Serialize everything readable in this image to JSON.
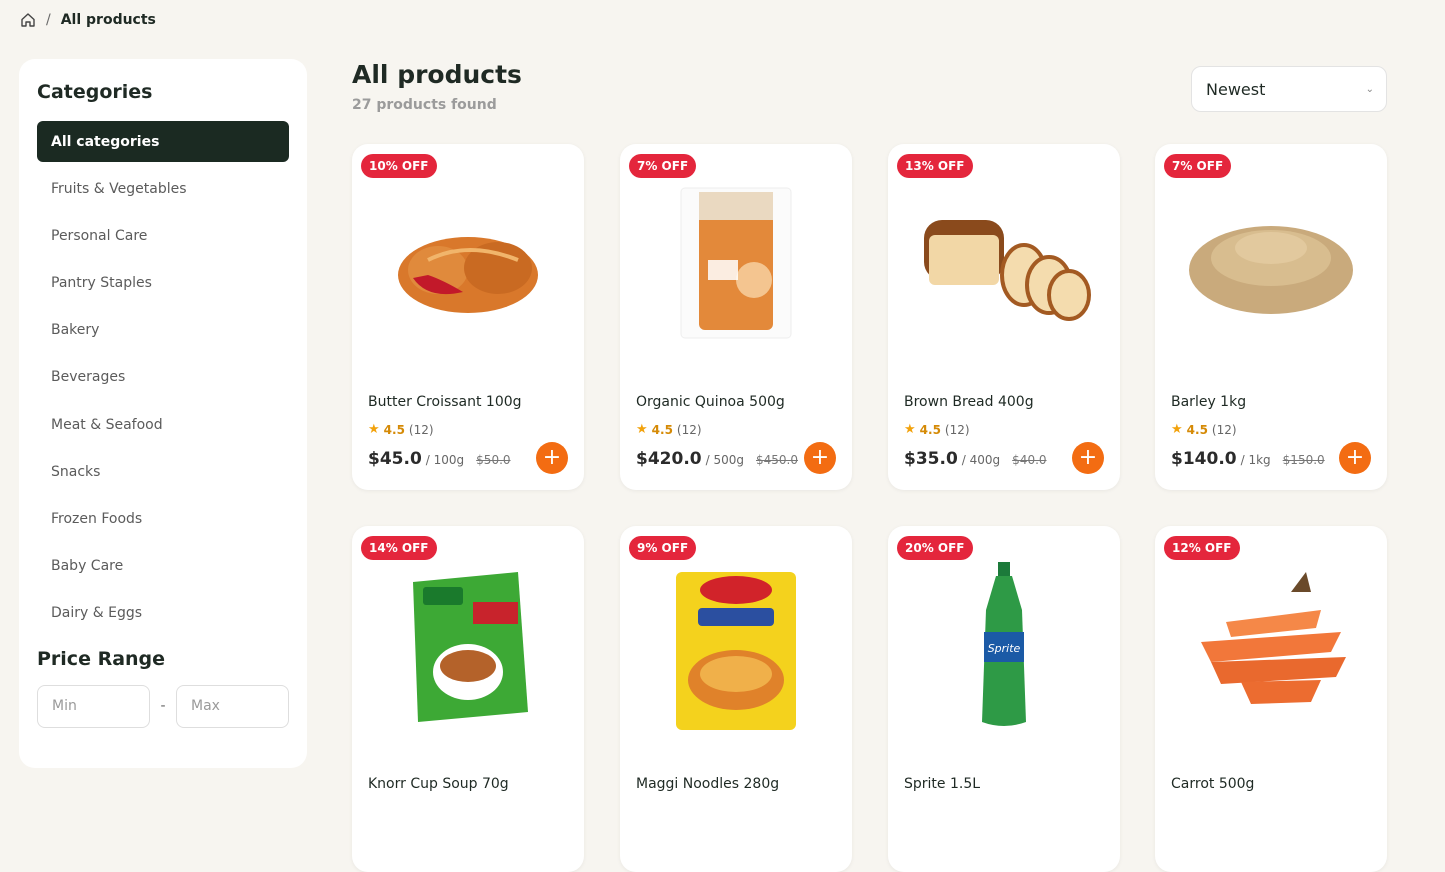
{
  "breadcrumb": {
    "separator": "/",
    "current": "All products"
  },
  "sidebar": {
    "categories_title": "Categories",
    "categories": [
      "All categories",
      "Fruits & Vegetables",
      "Personal Care",
      "Pantry Staples",
      "Bakery",
      "Beverages",
      "Meat & Seafood",
      "Snacks",
      "Frozen Foods",
      "Baby Care",
      "Dairy & Eggs"
    ],
    "active_category": "All categories",
    "price_title": "Price Range",
    "min_placeholder": "Min",
    "max_placeholder": "Max",
    "dash": "-"
  },
  "main": {
    "title": "All products",
    "found": "27 products found",
    "sort": {
      "selected": "Newest"
    }
  },
  "colors": {
    "accent": "#f36c12",
    "badge": "#e4263c",
    "active": "#1b2a22",
    "star": "#f2a20c"
  },
  "products": [
    {
      "badge": "10% OFF",
      "name": "Butter Croissant 100g",
      "rating": "4.5",
      "reviews": "(12)",
      "price": "$45.0",
      "unit": "/ 100g",
      "old": "$50.0",
      "icon": "croissant-icon"
    },
    {
      "badge": "7% OFF",
      "name": "Organic Quinoa 500g",
      "rating": "4.5",
      "reviews": "(12)",
      "price": "$420.0",
      "unit": "/ 500g",
      "old": "$450.0",
      "icon": "quinoa-bag-icon"
    },
    {
      "badge": "13% OFF",
      "name": "Brown Bread 400g",
      "rating": "4.5",
      "reviews": "(12)",
      "price": "$35.0",
      "unit": "/ 400g",
      "old": "$40.0",
      "icon": "bread-icon"
    },
    {
      "badge": "7% OFF",
      "name": "Barley 1kg",
      "rating": "4.5",
      "reviews": "(12)",
      "price": "$140.0",
      "unit": "/ 1kg",
      "old": "$150.0",
      "icon": "barley-grains-icon"
    },
    {
      "badge": "14% OFF",
      "name": "Knorr Cup Soup 70g",
      "icon": "soup-box-icon"
    },
    {
      "badge": "9% OFF",
      "name": "Maggi Noodles 280g",
      "icon": "noodles-pack-icon"
    },
    {
      "badge": "20% OFF",
      "name": "Sprite 1.5L",
      "icon": "soda-bottle-icon"
    },
    {
      "badge": "12% OFF",
      "name": "Carrot 500g",
      "icon": "carrots-icon"
    }
  ]
}
